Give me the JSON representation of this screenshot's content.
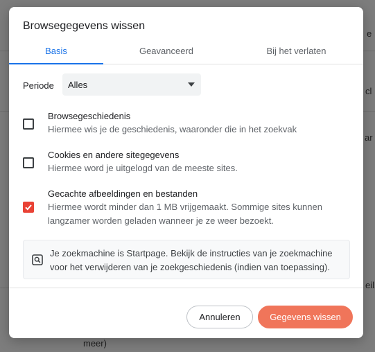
{
  "background": {
    "fragments": [
      "e",
      "cl",
      "ar B",
      "eil",
      "Hiermee wis je de geschiedenis,",
      "meer)"
    ]
  },
  "dialog": {
    "title": "Browsegegevens wissen",
    "tabs": [
      {
        "label": "Basis",
        "active": true
      },
      {
        "label": "Geavanceerd",
        "active": false
      },
      {
        "label": "Bij het verlaten",
        "active": false
      }
    ],
    "period": {
      "label": "Periode",
      "value": "Alles"
    },
    "options": [
      {
        "title": "Browsegeschiedenis",
        "description": "Hiermee wis je de geschiedenis, waaronder die in het zoekvak",
        "checked": false
      },
      {
        "title": "Cookies en andere sitegegevens",
        "description": "Hiermee word je uitgelogd van de meeste sites.",
        "checked": false
      },
      {
        "title": "Gecachte afbeeldingen en bestanden",
        "description": "Hiermee wordt minder dan 1 MB vrijgemaakt. Sommige sites kunnen langzamer worden geladen wanneer je ze weer bezoekt.",
        "checked": true
      }
    ],
    "info": {
      "icon": "search-engine-icon",
      "text": "Je zoekmachine is Startpage. Bekijk de instructies van je zoekmachine voor het verwijderen van je zoekgeschiedenis (indien van toepassing)."
    },
    "buttons": {
      "cancel": "Annuleren",
      "clear": "Gegevens wissen"
    }
  },
  "colors": {
    "accent": "#1a73e8",
    "checkbox_checked": "#e94235",
    "primary_button": "#f0755a"
  }
}
